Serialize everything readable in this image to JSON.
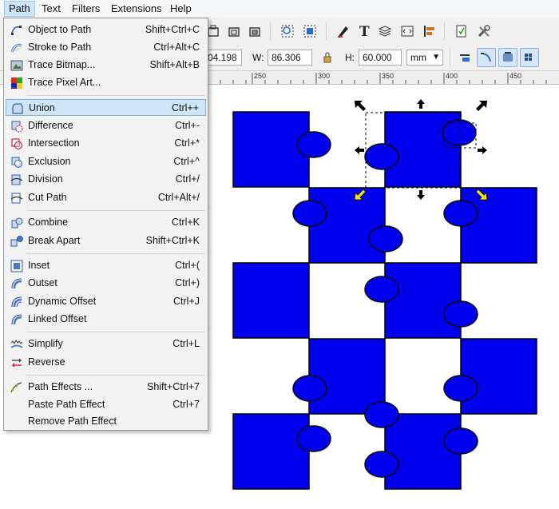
{
  "menubar": {
    "items": [
      {
        "label": "Path",
        "active": true
      },
      {
        "label": "Text"
      },
      {
        "label": "Filters"
      },
      {
        "label": "Extensions"
      },
      {
        "label": "Help"
      }
    ]
  },
  "toolbar": {
    "x_value": "04.198",
    "w_label": "W:",
    "w_value": "86.306",
    "h_label": "H:",
    "h_value": "60.000",
    "unit": "mm"
  },
  "ruler": {
    "ticks": [
      "250",
      "300",
      "350",
      "400",
      "450"
    ]
  },
  "path_menu": {
    "items": [
      {
        "label": "Object to Path",
        "shortcut": "Shift+Ctrl+C",
        "icon": "object-to-path-icon"
      },
      {
        "label": "Stroke to Path",
        "shortcut": "Ctrl+Alt+C",
        "icon": "stroke-to-path-icon"
      },
      {
        "label": "Trace Bitmap...",
        "shortcut": "Shift+Alt+B",
        "icon": "trace-bitmap-icon"
      },
      {
        "label": "Trace Pixel Art...",
        "shortcut": "",
        "icon": "trace-pixel-art-icon"
      },
      {
        "label": "Union",
        "shortcut": "Ctrl++",
        "icon": "union-icon",
        "highlighted": true
      },
      {
        "label": "Difference",
        "shortcut": "Ctrl+-",
        "icon": "difference-icon"
      },
      {
        "label": "Intersection",
        "shortcut": "Ctrl+*",
        "icon": "intersection-icon"
      },
      {
        "label": "Exclusion",
        "shortcut": "Ctrl+^",
        "icon": "exclusion-icon"
      },
      {
        "label": "Division",
        "shortcut": "Ctrl+/",
        "icon": "division-icon"
      },
      {
        "label": "Cut Path",
        "shortcut": "Ctrl+Alt+/",
        "icon": "cut-path-icon"
      },
      {
        "label": "Combine",
        "shortcut": "Ctrl+K",
        "icon": "combine-icon"
      },
      {
        "label": "Break Apart",
        "shortcut": "Shift+Ctrl+K",
        "icon": "break-apart-icon"
      },
      {
        "label": "Inset",
        "shortcut": "Ctrl+(",
        "icon": "inset-icon"
      },
      {
        "label": "Outset",
        "shortcut": "Ctrl+)",
        "icon": "outset-icon"
      },
      {
        "label": "Dynamic Offset",
        "shortcut": "Ctrl+J",
        "icon": "dynamic-offset-icon"
      },
      {
        "label": "Linked Offset",
        "shortcut": "",
        "icon": "linked-offset-icon"
      },
      {
        "label": "Simplify",
        "shortcut": "Ctrl+L",
        "icon": "simplify-icon"
      },
      {
        "label": "Reverse",
        "shortcut": "",
        "icon": "reverse-icon"
      },
      {
        "label": "Path Effects ...",
        "shortcut": "Shift+Ctrl+7",
        "icon": "path-effects-icon"
      },
      {
        "label": "Paste Path Effect",
        "shortcut": "Ctrl+7",
        "icon": ""
      },
      {
        "label": "Remove Path Effect",
        "shortcut": "",
        "icon": ""
      }
    ]
  },
  "colors": {
    "piece_fill": "#0000ee",
    "piece_stroke": "#000000",
    "menu_highlight": "#cde6f7"
  }
}
